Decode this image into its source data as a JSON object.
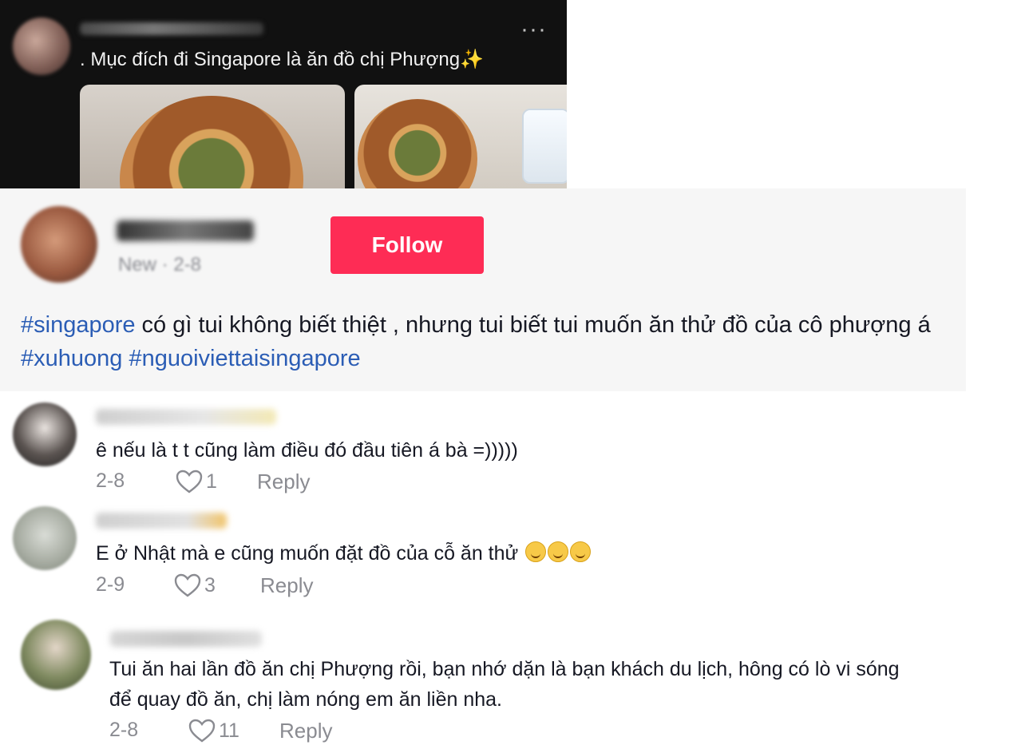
{
  "top_post": {
    "more_label": "···",
    "caption": ". Mục đích đi Singapore là ăn đồ chị Phượng",
    "sparkle": "✨"
  },
  "post": {
    "meta": "New · 2-8",
    "follow_label": "Follow",
    "text": {
      "tag1": "#singapore",
      "body1": " có gì tui không biết thiệt , nhưng tui biết tui muốn ăn thử đồ của cô phượng á ",
      "tag2": "#xuhuong",
      "space": " ",
      "tag3": "#nguoiviettaisingapore"
    }
  },
  "comments": [
    {
      "text": "ê nếu là t t cũng làm điều đó đầu tiên á bà =)))))",
      "date": "2-8",
      "likes": "1",
      "reply_label": "Reply"
    },
    {
      "text": "E ở Nhật mà e cũng muốn đặt đồ của cỗ ăn thử",
      "emoji_count": 3,
      "date": "2-9",
      "likes": "3",
      "reply_label": "Reply"
    },
    {
      "text_line1": "Tui ăn hai lần đồ ăn chị Phượng rồi, bạn nhớ dặn là bạn khách du lịch, hông có lò vi sóng",
      "text_line2": "để quay đồ ăn, chị làm nóng em ăn liền nha.",
      "date": "2-8",
      "likes": "11",
      "reply_label": "Reply"
    }
  ],
  "colors": {
    "follow_bg": "#fe2c55",
    "hashtag": "#2b5db5",
    "muted": "#8a8b91"
  }
}
